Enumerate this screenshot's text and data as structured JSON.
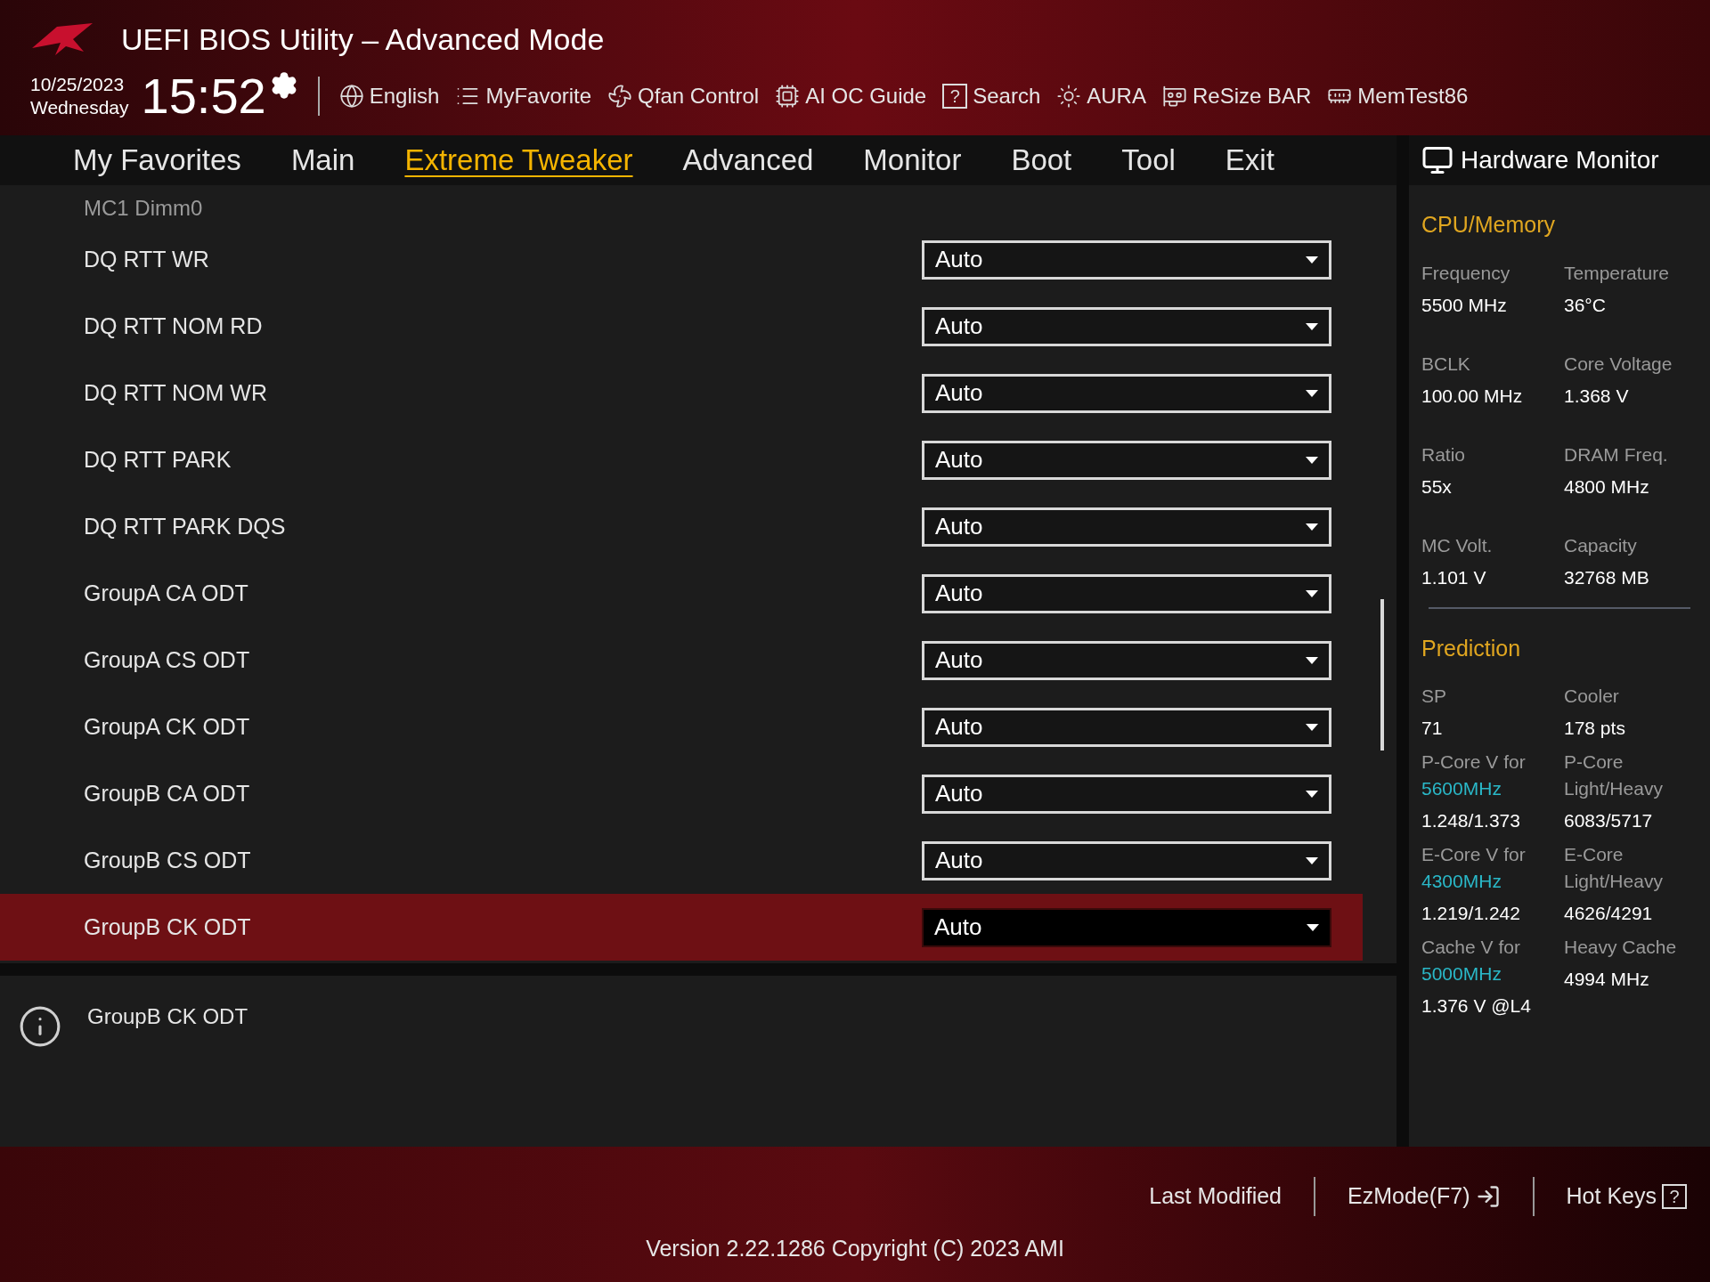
{
  "header": {
    "title": "UEFI BIOS Utility – Advanced Mode",
    "date": "10/25/2023",
    "weekday": "Wednesday",
    "time": "15:52",
    "toolbar": [
      {
        "kind": "globe",
        "label": "English"
      },
      {
        "kind": "list",
        "label": "MyFavorite"
      },
      {
        "kind": "fan",
        "label": "Qfan Control"
      },
      {
        "kind": "chip",
        "label": "AI OC Guide"
      },
      {
        "kind": "help",
        "label": "Search",
        "glyph": "?"
      },
      {
        "kind": "sun",
        "label": "AURA"
      },
      {
        "kind": "card",
        "label": "ReSize BAR"
      },
      {
        "kind": "memory",
        "label": "MemTest86"
      }
    ]
  },
  "tabs": [
    {
      "label": "My Favorites",
      "selected": false
    },
    {
      "label": "Main",
      "selected": false
    },
    {
      "label": "Extreme Tweaker",
      "selected": true
    },
    {
      "label": "Advanced",
      "selected": false
    },
    {
      "label": "Monitor",
      "selected": false
    },
    {
      "label": "Boot",
      "selected": false
    },
    {
      "label": "Tool",
      "selected": false
    },
    {
      "label": "Exit",
      "selected": false
    }
  ],
  "settings": {
    "subsection": "MC1 Dimm0",
    "rows": [
      {
        "label": "DQ RTT WR",
        "value": "Auto",
        "selected": false
      },
      {
        "label": "DQ RTT NOM RD",
        "value": "Auto",
        "selected": false
      },
      {
        "label": "DQ RTT NOM WR",
        "value": "Auto",
        "selected": false
      },
      {
        "label": "DQ RTT PARK",
        "value": "Auto",
        "selected": false
      },
      {
        "label": "DQ RTT PARK DQS",
        "value": "Auto",
        "selected": false
      },
      {
        "label": "GroupA CA ODT",
        "value": "Auto",
        "selected": false
      },
      {
        "label": "GroupA CS ODT",
        "value": "Auto",
        "selected": false
      },
      {
        "label": "GroupA CK ODT",
        "value": "Auto",
        "selected": false
      },
      {
        "label": "GroupB CA ODT",
        "value": "Auto",
        "selected": false
      },
      {
        "label": "GroupB CS ODT",
        "value": "Auto",
        "selected": false
      },
      {
        "label": "GroupB CK ODT",
        "value": "Auto",
        "selected": true
      }
    ]
  },
  "help": {
    "text": "GroupB CK ODT"
  },
  "hardware_monitor": {
    "title": "Hardware Monitor",
    "sections": [
      {
        "title": "CPU/Memory",
        "items": [
          {
            "label": "Frequency",
            "value": "5500 MHz"
          },
          {
            "label": "Temperature",
            "value": "36°C"
          },
          {
            "label": "BCLK",
            "value": "100.00 MHz"
          },
          {
            "label": "Core Voltage",
            "value": "1.368 V"
          },
          {
            "label": "Ratio",
            "value": "55x"
          },
          {
            "label": "DRAM Freq.",
            "value": "4800 MHz"
          },
          {
            "label": "MC Volt.",
            "value": "1.101 V"
          },
          {
            "label": "Capacity",
            "value": "32768 MB"
          }
        ]
      },
      {
        "title": "Prediction",
        "items": [
          {
            "label": "SP",
            "value": "71"
          },
          {
            "label": "Cooler",
            "value": "178 pts"
          },
          {
            "label": "P-Core V for",
            "freq": "5600MHz",
            "value": "1.248/1.373"
          },
          {
            "label": "P-Core Light/Heavy",
            "value": "6083/5717"
          },
          {
            "label": "E-Core V for",
            "freq": "4300MHz",
            "value": "1.219/1.242"
          },
          {
            "label": "E-Core Light/Heavy",
            "value": "4626/4291"
          },
          {
            "label": "Cache V for",
            "freq": "5000MHz",
            "value": "1.376 V @L4"
          },
          {
            "label": "Heavy Cache",
            "value": "4994 MHz"
          }
        ]
      }
    ]
  },
  "footer": {
    "actions": [
      {
        "kind": "plain",
        "label": "Last Modified"
      },
      {
        "kind": "exit",
        "label": "EzMode(F7)"
      },
      {
        "kind": "help",
        "label": "Hot Keys",
        "glyph": "?"
      }
    ],
    "version": "Version 2.22.1286 Copyright (C) 2023 AMI"
  }
}
